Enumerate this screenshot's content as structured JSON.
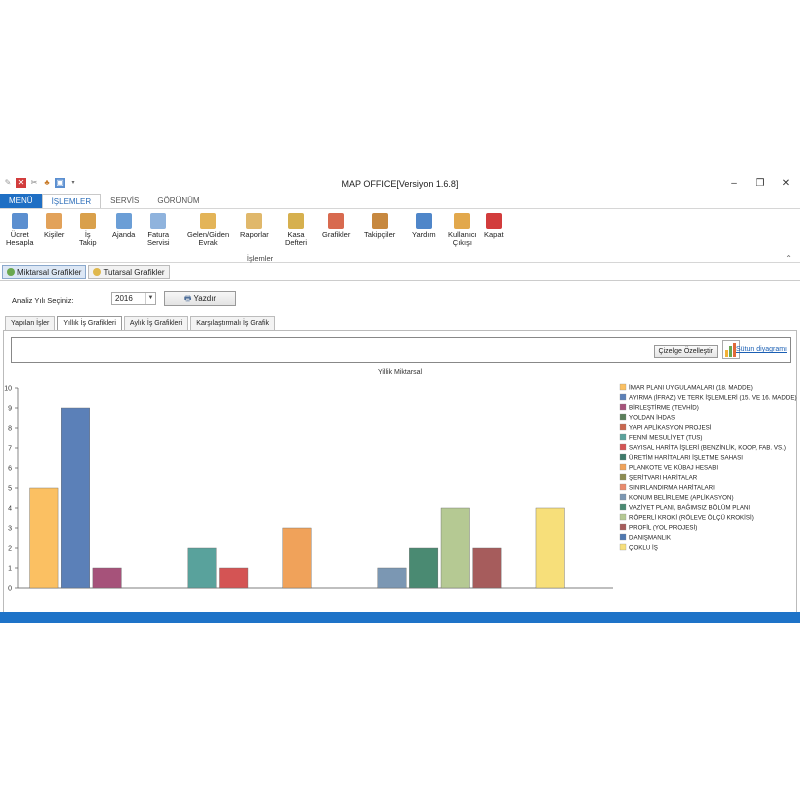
{
  "window": {
    "title": "MAP OFFICE[Versiyon 1.6.8]",
    "minimize": "–",
    "maximize": "❐",
    "close": "✕"
  },
  "ribbon_tabs": [
    {
      "label": "MENÜ"
    },
    {
      "label": "İŞLEMLER"
    },
    {
      "label": "SERVİS"
    },
    {
      "label": "GÖRÜNÜM"
    }
  ],
  "ribbon": {
    "buttons": [
      {
        "label": "Ücret\nHesapla",
        "icon": "list-icon",
        "color": "#5b8fd0"
      },
      {
        "label": "Kişiler",
        "icon": "person-icon",
        "color": "#e2a25a"
      },
      {
        "label": "İş\nTakip",
        "icon": "clipboard-icon",
        "color": "#d9a04b"
      },
      {
        "label": "Ajanda",
        "icon": "calendar-icon",
        "color": "#6b9ed6"
      },
      {
        "label": "Fatura\nServisi",
        "icon": "invoice-icon",
        "color": "#8fb3dd"
      },
      {
        "label": "Gelen/Giden\nEvrak",
        "icon": "folder-icon",
        "color": "#e3b458"
      },
      {
        "label": "Raporlar",
        "icon": "report-icon",
        "color": "#e0b86b"
      },
      {
        "label": "Kasa\nDefteri",
        "icon": "money-icon",
        "color": "#d6b04e"
      },
      {
        "label": "Grafikler",
        "icon": "pie-chart-icon",
        "color": "#d86a4f"
      },
      {
        "label": "Takipçiler",
        "icon": "people-icon",
        "color": "#c7883f"
      },
      {
        "label": "Yardım",
        "icon": "help-icon",
        "color": "#4f86c9"
      },
      {
        "label": "Kullanıcı\nÇıkışı",
        "icon": "tag-icon",
        "color": "#e2a84c"
      },
      {
        "label": "Kapat",
        "icon": "close-icon",
        "color": "#d23c3c"
      }
    ],
    "group_label": "İşlemler"
  },
  "tool_tabs": [
    {
      "label": "Miktarsal Grafikler",
      "color": "#6aa84f"
    },
    {
      "label": "Tutarsal Grafikler",
      "color": "#e0b84c"
    }
  ],
  "filter": {
    "year_label": "Analiz Yılı Seçiniz:",
    "year_value": "2016",
    "print_label": "Yazdır"
  },
  "sub_tabs": [
    {
      "label": "Yapılan İşler"
    },
    {
      "label": "Yıllık İş Grafikleri"
    },
    {
      "label": "Aylık İş Grafikleri"
    },
    {
      "label": "Karşılaştırmalı İş Grafik"
    }
  ],
  "chart_controls": {
    "properties_label": "Çizelge Özelleştir",
    "type_link": "Sütun diyagramı"
  },
  "chart_data": {
    "type": "bar",
    "title": "Yillik Miktarsal",
    "ylim": [
      0,
      10
    ],
    "yticks": [
      0,
      1,
      2,
      3,
      4,
      5,
      6,
      7,
      8,
      9,
      10
    ],
    "grid": false,
    "legend_position": "right",
    "series": [
      {
        "name": "İMAR PLANI UYGULAMALARI (18. MADDE)",
        "color": "#fbc062",
        "value": 5
      },
      {
        "name": "AYIRMA (İFRAZ) VE TERK İŞLEMLERİ (15. VE 16. MADDE)",
        "color": "#5b80b8",
        "value": 9
      },
      {
        "name": "BİRLEŞTİRME (TEVHİD)",
        "color": "#a6527a",
        "value": 1
      },
      {
        "name": "YOLDAN İHDAS",
        "color": "#5a7f5a",
        "value": 0
      },
      {
        "name": "YAPI APLİKASYON PROJESİ",
        "color": "#c9674f",
        "value": 0
      },
      {
        "name": "FENNİ MESULİYET (TUS)",
        "color": "#59a29c",
        "value": 2
      },
      {
        "name": "SAYISAL HARİTA İŞLERİ (BENZİNLİK, KOOP, FAB. VS.)",
        "color": "#d45454",
        "value": 1
      },
      {
        "name": "ÜRETİM HARİTALARI İŞLETME SAHASI",
        "color": "#3d7a6a",
        "value": 0
      },
      {
        "name": "PLANKOTE VE KÜBAJ HESABI",
        "color": "#f0a25a",
        "value": 3
      },
      {
        "name": "ŞERİTVARI HARİTALAR",
        "color": "#8c8c52",
        "value": 0
      },
      {
        "name": "SINIRLANDIRMA HARİTALARI",
        "color": "#e98b6e",
        "value": 0
      },
      {
        "name": "KONUM BELİRLEME (APLİKASYON)",
        "color": "#7b97b3",
        "value": 1
      },
      {
        "name": "VAZİYET PLANI, BAĞIMSIZ BÖLÜM PLANI",
        "color": "#4a8a72",
        "value": 2
      },
      {
        "name": "RÖPERLİ KROKİ (RÖLEVE ÖLÇÜ KROKİSİ)",
        "color": "#b5c993",
        "value": 4
      },
      {
        "name": "PROFİL (YOL PROJESİ)",
        "color": "#a65c5c",
        "value": 2
      },
      {
        "name": "DANIŞMANLIK",
        "color": "#4e78b0",
        "value": 0
      },
      {
        "name": "ÇOKLU İŞ",
        "color": "#f7df7a",
        "value": 4
      }
    ]
  }
}
